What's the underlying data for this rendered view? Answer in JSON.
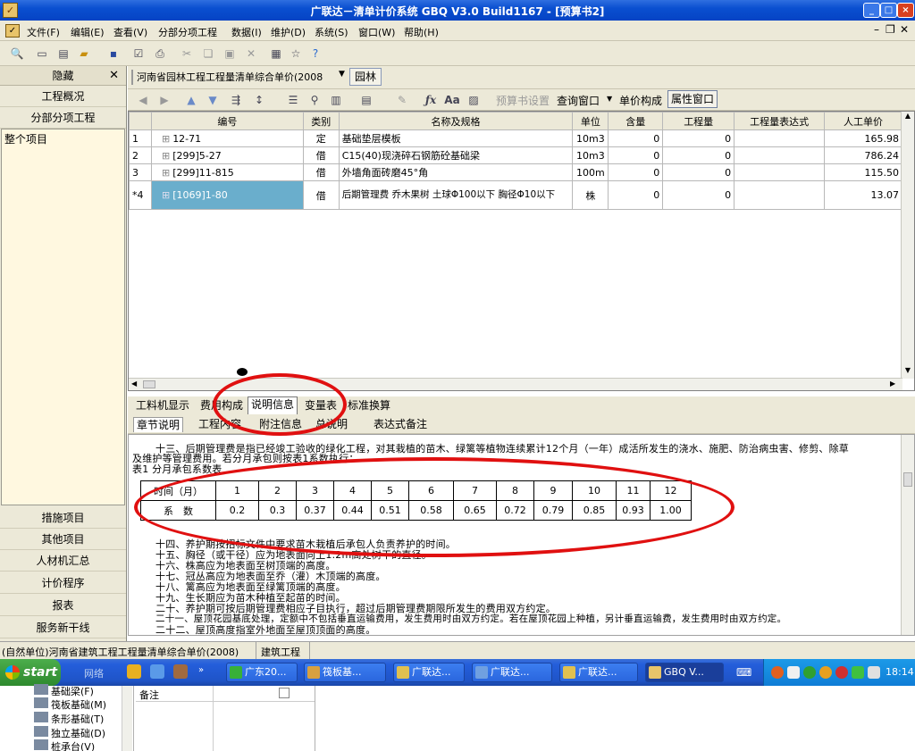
{
  "window": {
    "title": "广联达－清单计价系统 GBQ V3.0 Build1167 - [预算书2]",
    "app_icon": "excel-like-icon"
  },
  "menu": [
    "文件(F)",
    "编辑(E)",
    "查看(V)",
    "分部分项工程",
    "数据(I)",
    "维护(D)",
    "系统(S)",
    "窗口(W)",
    "帮助(H)"
  ],
  "left_panel": {
    "header": "隐藏",
    "top_items": [
      "工程概况",
      "分部分项工程"
    ],
    "tree_root": "整个项目",
    "bottom_items": [
      "措施项目",
      "其他项目",
      "人材机汇总",
      "计价程序",
      "报表",
      "服务新干线"
    ]
  },
  "context_bar": {
    "quota_library": "河南省园林工程工程量清单综合单价(2008",
    "tag": "园林"
  },
  "toolbar2": {
    "budget_settings": "预算书设置",
    "query_window": "查询窗口",
    "unit_price_composition": "单价构成",
    "property_window": "属性窗口"
  },
  "grid": {
    "columns": [
      "",
      "编号",
      "类别",
      "名称及规格",
      "单位",
      "含量",
      "工程量",
      "工程量表达式",
      "人工单价"
    ],
    "rows": [
      {
        "idx": "1",
        "code": "12-71",
        "type": "定",
        "name": "基础垫层模板",
        "unit": "10m3",
        "content": "0",
        "qty": "0",
        "expr": "",
        "price": "165.98"
      },
      {
        "idx": "2",
        "code": "[299]5-27",
        "type": "借",
        "name": "C15(40)现浇碎石钢筋砼基础梁",
        "unit": "10m3",
        "content": "0",
        "qty": "0",
        "expr": "",
        "price": "786.24"
      },
      {
        "idx": "3",
        "code": "[299]11-815",
        "type": "借",
        "name": "外墙角面砖磨45°角",
        "unit": "100m",
        "content": "0",
        "qty": "0",
        "expr": "",
        "price": "115.50"
      },
      {
        "idx": "*4",
        "code": "[1069]1-80",
        "type": "借",
        "name": "后期管理费 乔木果树 土球Φ100以下 胸径Φ10以下",
        "unit": "株",
        "content": "0",
        "qty": "0",
        "expr": "",
        "price": "13.07"
      }
    ]
  },
  "bottom_tabs": [
    "工料机显示",
    "费用构成",
    "说明信息",
    "变量表",
    "标准换算"
  ],
  "sub_tabs": [
    "章节说明",
    "工程内容",
    "附注信息",
    "总说明",
    "表达式备注"
  ],
  "description": {
    "para13": "十三、后期管理费是指已经竣工验收的绿化工程，对其栽植的苗木、绿篱等植物连续累计12个月（一年）成活所发生的浇水、施肥、防治病虫害、修剪、除草",
    "para13b": "及维护等管理费用。若分月承包则按表1系数执行：",
    "table_caption": "表1  分月承包系数表",
    "coef_header": [
      "时间（月）",
      "1",
      "2",
      "3",
      "4",
      "5",
      "6",
      "7",
      "8",
      "9",
      "10",
      "11",
      "12"
    ],
    "coef_values": [
      "系　数",
      "0.2",
      "0.3",
      "0.37",
      "0.44",
      "0.51",
      "0.58",
      "0.65",
      "0.72",
      "0.79",
      "0.85",
      "0.93",
      "1.00"
    ],
    "lines": [
      "十四、养护期按招标文件中要求苗木栽植后承包人负责养护的时间。",
      "十五、胸径（或干径）应为地表面向上1.2m高处树干的直径。",
      "十六、株高应为地表面至树顶端的高度。",
      "十七、冠丛高应为地表面至乔（灌）木顶端的高度。",
      "十八、篱高应为地表面至绿篱顶端的高度。",
      "十九、生长期应为苗木种植至起苗的时间。",
      "二十、养护期可按后期管理费相应子目执行，超过后期管理费期限所发生的费用双方约定。",
      "二十一、屋顶花园基底处理，定额中不包括垂直运输费用，发生费用时由双方约定。若在屋顶花园上种植，另计垂直运输费，发生费用时由双方约定。",
      "二十二、屋顶高度指室外地面至屋顶顶面的高度。"
    ]
  },
  "status": {
    "unit": "(自然单位)河南省建筑工程工程量清单综合单价(2008)",
    "type": "建筑工程"
  },
  "taskbar": {
    "start": "start",
    "quick": "网络",
    "tasks": [
      "广东20...",
      "筏板基...",
      "广联达...",
      "广联达...",
      "广联达...",
      "GBQ V..."
    ],
    "clock": "18:14"
  },
  "background_window": {
    "tree_items": [
      "基础梁(F)",
      "筏板基础(M)",
      "条形基础(T)",
      "独立基础(D)",
      "桩承台(V)"
    ],
    "cell_label": "备注"
  },
  "colors": {
    "annotation": "#e01010",
    "selected_cell": "#6aaecc",
    "tree_bg": "#fff8e0"
  }
}
